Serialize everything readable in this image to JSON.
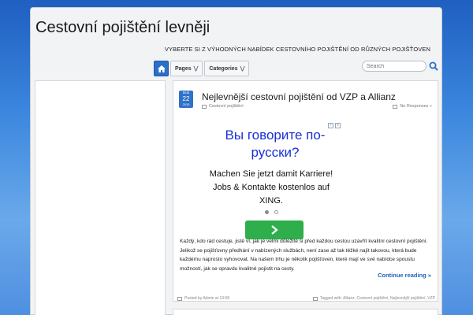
{
  "site": {
    "title": "Cestovní pojištění levněji",
    "tagline": "VYBERTE SI Z VÝHODNÝCH NABÍDEK CESTOVNÍHO POJIŠTĚNÍ OD RŮZNÝCH POJIŠŤOVEN"
  },
  "nav": {
    "home_icon": "home-icon",
    "items": [
      {
        "label": "Pages"
      },
      {
        "label": "Categories"
      }
    ]
  },
  "search": {
    "placeholder": "Search"
  },
  "post": {
    "date": {
      "month": "Dub",
      "day": "22",
      "year": "2015"
    },
    "title": "Nejlevnější cestovní pojištění od VZP a Allianz",
    "category": "Cestovní pojištění",
    "responses": "No Responses »",
    "ad": {
      "headline": "Вы говорите по-русски?",
      "body": "Machen Sie jetzt damit Karriere! Jobs & Kontakte kostenlos auf XING.",
      "badge_i": "i",
      "badge_x": "x"
    },
    "excerpt": "Každý, kdo rád cestuje, jistě ví, jak je velmi důležité si před každou cestou uzavřít kvalitní cestovní pojištění. Jelikož se pojišťovny předhání v nabízených službách, není zase až tak těžké najít takovou, která bude každému naprosto vyhovovat. Na našem trhu je několik pojišťoven, které mají ve své nabídce spoustu možností, jak se opravdu kvalitně pojistit na cesty.",
    "continue": "Continue reading »",
    "footer_left": "Posted by Admin at 13:08",
    "footer_right": "Tagged with: Allianz, Cestovní pojištění, Nejlevnější pojištění, VZP"
  },
  "colors": {
    "accent": "#2f72c9",
    "link": "#2264b9",
    "ad_cta": "#2fae4c",
    "ad_headline": "#1a2fd6"
  }
}
